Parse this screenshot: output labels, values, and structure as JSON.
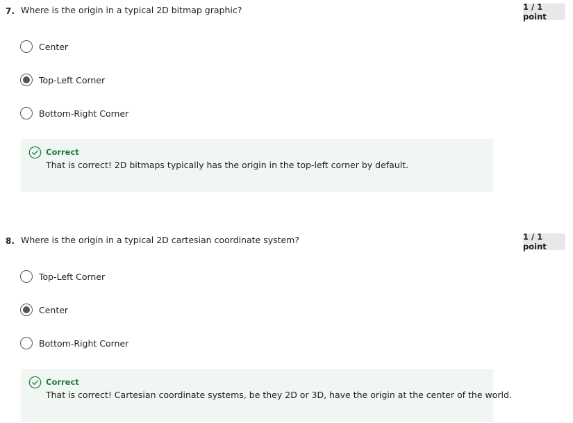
{
  "questions": [
    {
      "number": "7.",
      "text": "Where is the origin in a typical 2D bitmap graphic?",
      "points": "1 / 1 point",
      "options": [
        {
          "label": "Center",
          "selected": false
        },
        {
          "label": "Top-Left Corner",
          "selected": true
        },
        {
          "label": "Bottom-Right Corner",
          "selected": false
        }
      ],
      "feedback": {
        "title": "Correct",
        "text": "That is correct! 2D bitmaps typically has the origin in the top-left corner by default."
      }
    },
    {
      "number": "8.",
      "text": "Where is the origin in a typical 2D cartesian coordinate system?",
      "points": "1 / 1 point",
      "options": [
        {
          "label": "Top-Left Corner",
          "selected": false
        },
        {
          "label": "Center",
          "selected": true
        },
        {
          "label": "Bottom-Right Corner",
          "selected": false
        }
      ],
      "feedback": {
        "title": "Correct",
        "text": "That is correct! Cartesian coordinate systems, be they 2D or 3D, have the origin at the center of the world."
      }
    }
  ],
  "colors": {
    "correct_green": "#1e7b3c",
    "feedback_bg": "#f0f6f2",
    "points_bg": "#e8e8e8"
  },
  "icons": {
    "feedback_icon": "check-circle-icon"
  }
}
